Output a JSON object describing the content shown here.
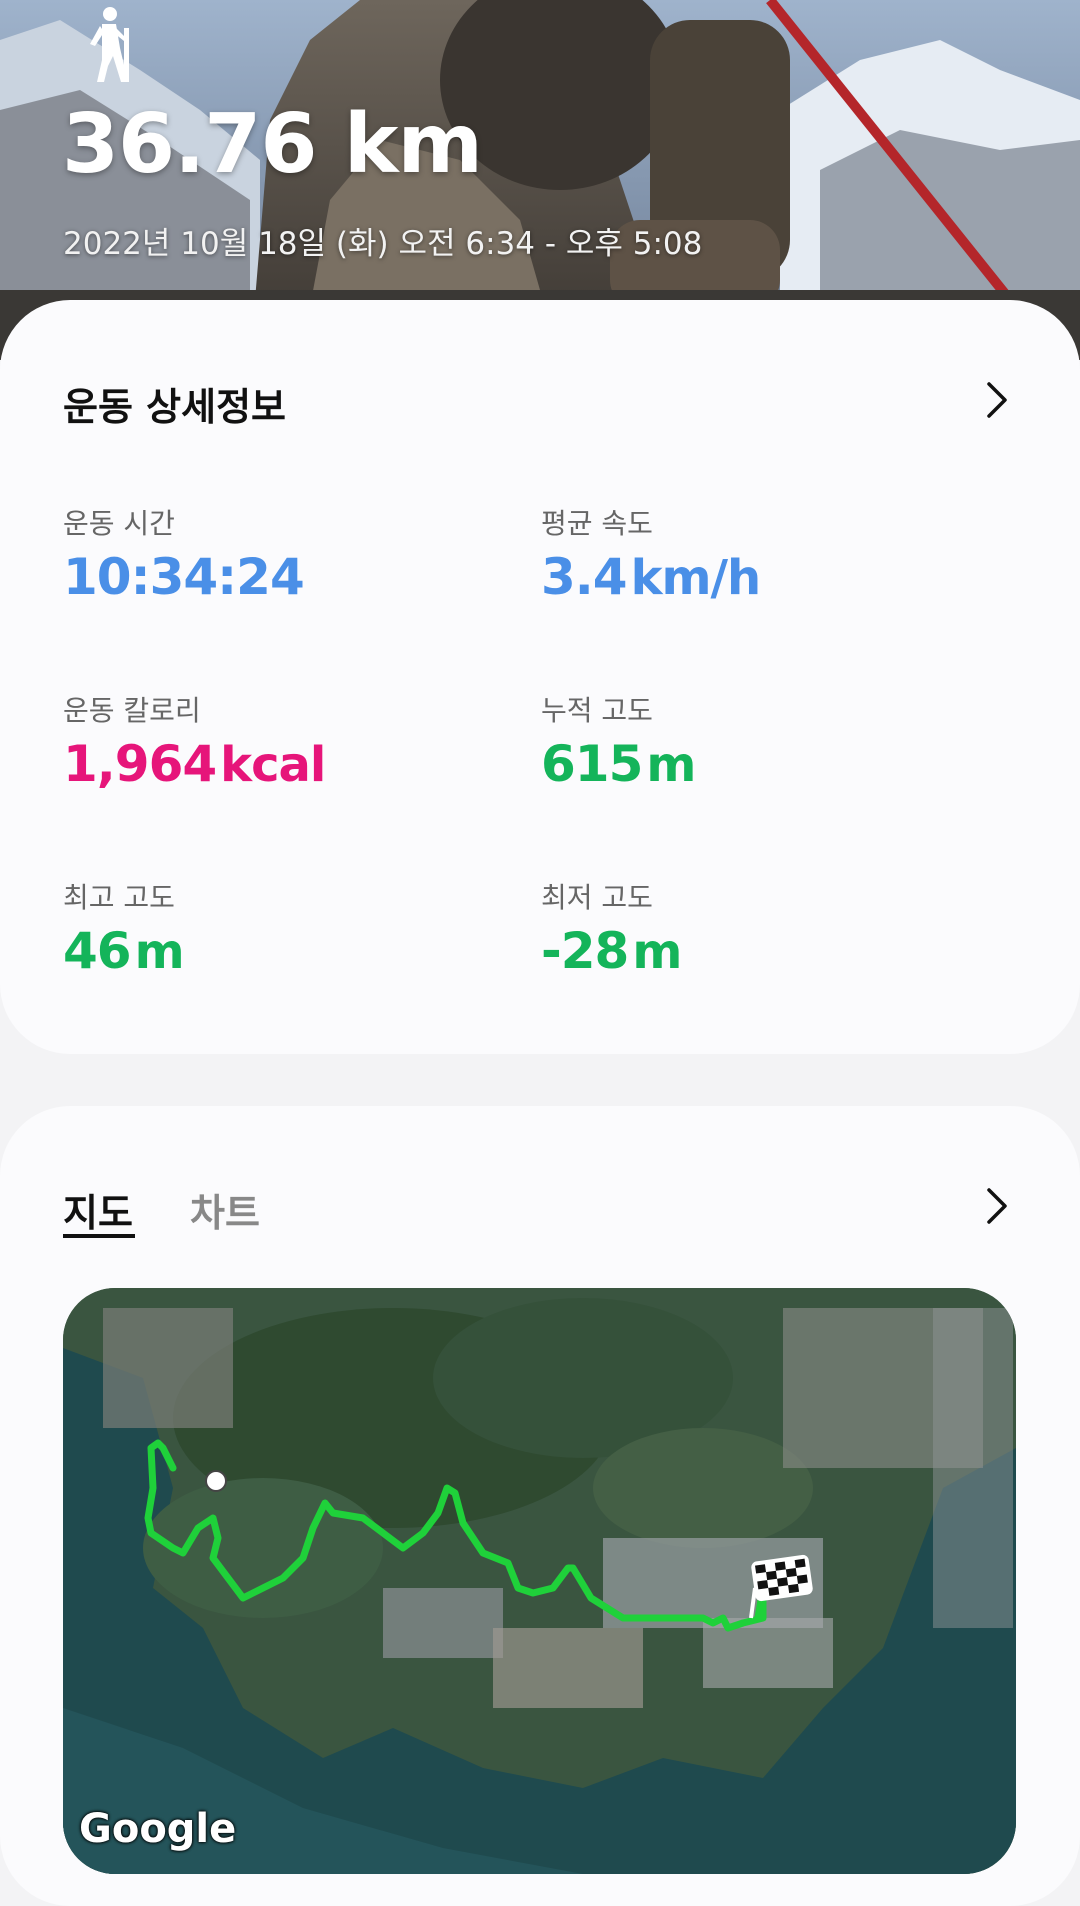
{
  "header": {
    "activity_icon": "hiking-icon",
    "distance": "36.76 km",
    "datetime": "2022년 10월 18일 (화) 오전 6:34 - 오후 5:08"
  },
  "details": {
    "title": "운동 상세정보",
    "stats": [
      {
        "label": "운동 시간",
        "value": "10:34:24",
        "unit": "",
        "color": "#4a8fe7"
      },
      {
        "label": "평균 속도",
        "value": "3.4",
        "unit": "km/h",
        "color": "#4a8fe7"
      },
      {
        "label": "운동 칼로리",
        "value": "1,964",
        "unit": "kcal",
        "color": "#e6157a"
      },
      {
        "label": "누적 고도",
        "value": "615",
        "unit": "m",
        "color": "#14b45a"
      },
      {
        "label": "최고 고도",
        "value": "46",
        "unit": "m",
        "color": "#14b45a"
      },
      {
        "label": "최저 고도",
        "value": "-28",
        "unit": "m",
        "color": "#14b45a"
      }
    ]
  },
  "map_section": {
    "tabs": [
      "지도",
      "차트"
    ],
    "active_tab": "지도",
    "attribution": "Google"
  },
  "colors": {
    "route": "#1fd13a",
    "blue": "#4a8fe7",
    "pink": "#e6157a",
    "green": "#14b45a"
  }
}
